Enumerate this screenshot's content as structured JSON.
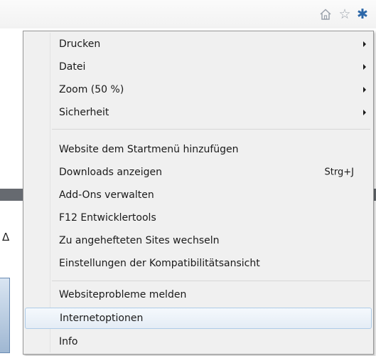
{
  "toolbar": {
    "icons": [
      "home-icon",
      "favorites-star-icon",
      "tools-gear-icon"
    ]
  },
  "page": {
    "glyph": "Δ"
  },
  "menu": {
    "items": [
      {
        "label": "Drucken",
        "submenu": true
      },
      {
        "label": "Datei",
        "submenu": true
      },
      {
        "label": "Zoom (50 %)",
        "submenu": true
      },
      {
        "label": "Sicherheit",
        "submenu": true
      },
      {
        "label": "Website dem Startmenü hinzufügen"
      },
      {
        "label": "Downloads anzeigen",
        "shortcut": "Strg+J"
      },
      {
        "label": "Add-Ons verwalten"
      },
      {
        "label": "F12 Entwicklertools"
      },
      {
        "label": "Zu angehefteten Sites wechseln"
      },
      {
        "label": "Einstellungen der Kompatibilitätsansicht"
      },
      {
        "label": "Websiteprobleme melden"
      },
      {
        "label": "Internetoptionen",
        "highlighted": true
      },
      {
        "label": "Info"
      }
    ]
  },
  "colors": {
    "gear_accent": "#2c67a8",
    "highlight_border": "#aecbe7",
    "menu_background": "#f0f0f0"
  }
}
